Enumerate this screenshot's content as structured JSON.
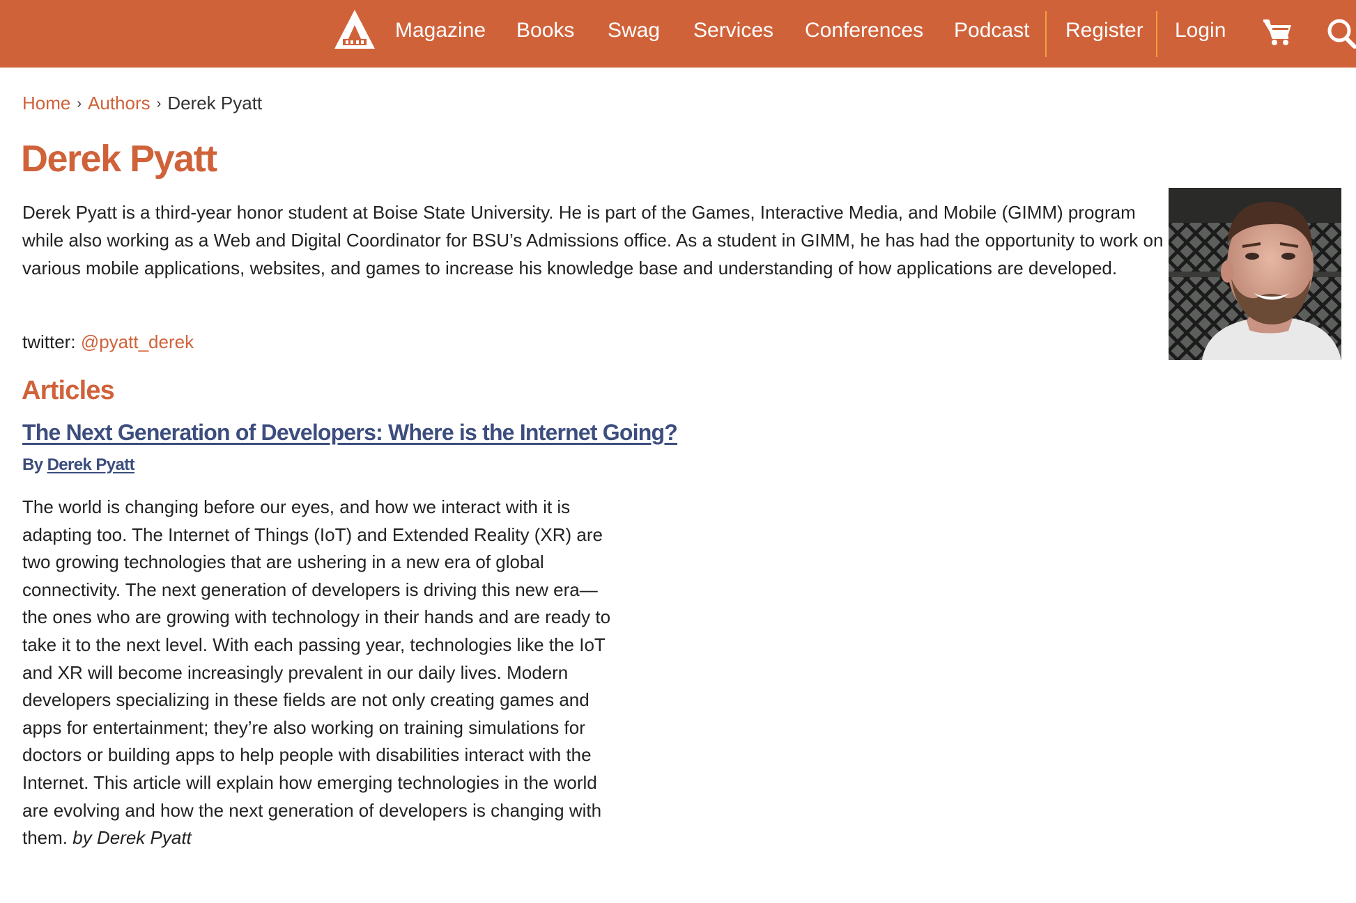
{
  "header": {
    "logo_alt": "A List Apart",
    "nav": [
      {
        "label": "Magazine"
      },
      {
        "label": "Books"
      },
      {
        "label": "Swag"
      },
      {
        "label": "Services"
      },
      {
        "label": "Conferences"
      },
      {
        "label": "Podcast"
      }
    ],
    "account": [
      {
        "label": "Register"
      },
      {
        "label": "Login"
      }
    ],
    "icons": [
      "cart-icon",
      "search-icon"
    ]
  },
  "breadcrumb": {
    "items": [
      {
        "label": "Home"
      },
      {
        "label": "Authors"
      }
    ],
    "separator": "›",
    "current": "Derek Pyatt"
  },
  "author": {
    "name": "Derek Pyatt",
    "bio": "Derek Pyatt is a third-year honor student at Boise State University. He is part of the Games, Interactive Media, and Mobile (GIMM) program while also working as a Web and Digital Coordinator for BSU’s Admissions office. As a student in GIMM, he has had the opportunity to work on various mobile applications, websites, and games to increase his knowledge base and understanding of how applications are developed.",
    "twitter_label": "twitter:",
    "twitter_handle": "@pyatt_derek"
  },
  "articles": {
    "heading": "Articles",
    "items": [
      {
        "title": "The Next Generation of Developers: Where is the Internet Going?",
        "by_label": "By",
        "author": "Derek Pyatt",
        "excerpt": "The world is changing before our eyes, and how we interact with it is adapting too. The Internet of Things (IoT) and Extended Reality (XR) are two growing technologies that are ushering in a new era of global connectivity. The next generation of developers is driving this new era—the ones who are growing with technology in their hands and are ready to take it to the next level. With each passing year, technologies like the IoT and XR will become increasingly prevalent in our daily lives. Modern developers specializing in these fields are not only creating games and apps for entertainment; they’re also working on training simulations for doctors or building apps to help people with disabilities interact with the Internet. This article will explain how emerging technologies in the world are evolving and how the next generation of developers is changing with them.",
        "excerpt_byline": "by Derek Pyatt"
      }
    ]
  },
  "colors": {
    "brand": "#d0623a",
    "nav_separator": "#f0a23b",
    "article_link": "#3c4d7e",
    "text": "#222222"
  }
}
